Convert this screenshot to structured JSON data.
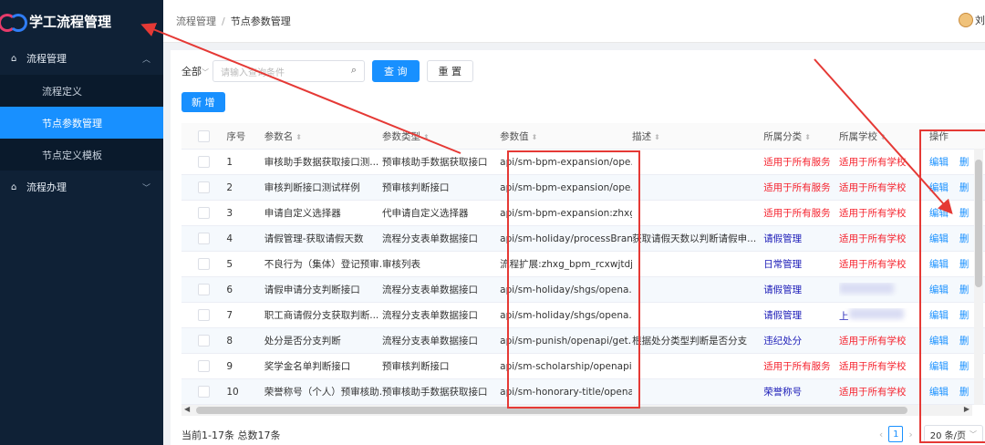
{
  "app": {
    "title": "学工流程管理"
  },
  "sidebar": {
    "groups": [
      {
        "label": "流程管理",
        "items": [
          "流程定义",
          "节点参数管理",
          "节点定义模板"
        ]
      },
      {
        "label": "流程办理"
      }
    ]
  },
  "header": {
    "breadcrumb": [
      "流程管理",
      "节点参数管理"
    ],
    "user_name": "刘"
  },
  "toolbar": {
    "scope": "全部",
    "search_placeholder": "请输入查询条件",
    "query_label": "查 询",
    "reset_label": "重 置",
    "add_label": "新 增"
  },
  "table": {
    "columns": [
      "序号",
      "参数名",
      "参数类型",
      "参数值",
      "描述",
      "所属分类",
      "所属学校",
      "操作"
    ],
    "rows": [
      {
        "idx": "1",
        "name": "审核助手数据获取接口测...",
        "type": "预审核助手数据获取接口",
        "value": "api/sm-bpm-expansion/ope...",
        "desc": "",
        "category": "适用于所有服务",
        "cat_color": "red",
        "school": "适用于所有学校",
        "sch_color": "red"
      },
      {
        "idx": "2",
        "name": "审核判断接口测试样例",
        "type": "预审核判断接口",
        "value": "api/sm-bpm-expansion/ope...",
        "desc": "",
        "category": "适用于所有服务",
        "cat_color": "red",
        "school": "适用于所有学校",
        "sch_color": "red"
      },
      {
        "idx": "3",
        "name": "申请自定义选择器",
        "type": "代申请自定义选择器",
        "value": "api/sm-bpm-expansion:zhxg...",
        "desc": "",
        "category": "适用于所有服务",
        "cat_color": "red",
        "school": "适用于所有学校",
        "sch_color": "red"
      },
      {
        "idx": "4",
        "name": "请假管理-获取请假天数",
        "type": "流程分支表单数据接口",
        "value": "api/sm-holiday/processBran...",
        "desc": "获取请假天数以判断请假申...",
        "category": "请假管理",
        "cat_color": "blue",
        "school": "适用于所有学校",
        "sch_color": "red"
      },
      {
        "idx": "5",
        "name": "不良行为（集体）登记预审...",
        "type": "审核列表",
        "value": "流程扩展:zhxg_bpm_rcxwjtdj...",
        "desc": "",
        "category": "日常管理",
        "cat_color": "blue",
        "school": "适用于所有学校",
        "sch_color": "red"
      },
      {
        "idx": "6",
        "name": "请假申请分支判断接口",
        "type": "流程分支表单数据接口",
        "value": "api/sm-holiday/shgs/opena...",
        "desc": "",
        "category": "请假管理",
        "cat_color": "blue",
        "school": "",
        "sch_color": "blur"
      },
      {
        "idx": "7",
        "name": "职工商请假分支获取判断...",
        "type": "流程分支表单数据接口",
        "value": "api/sm-holiday/shgs/opena...",
        "desc": "",
        "category": "请假管理",
        "cat_color": "blue",
        "school": "上",
        "sch_color": "blur"
      },
      {
        "idx": "8",
        "name": "处分是否分支判断",
        "type": "流程分支表单数据接口",
        "value": "api/sm-punish/openapi/get...",
        "desc": "根据处分类型判断是否分支",
        "category": "违纪处分",
        "cat_color": "blue",
        "school": "适用于所有学校",
        "sch_color": "red"
      },
      {
        "idx": "9",
        "name": "奖学金名单判断接口",
        "type": "预审核判断接口",
        "value": "api/sm-scholarship/openapi...",
        "desc": "",
        "category": "适用于所有服务",
        "cat_color": "red",
        "school": "适用于所有学校",
        "sch_color": "red"
      },
      {
        "idx": "10",
        "name": "荣誉称号（个人）预审核助...",
        "type": "预审核助手数据获取接口",
        "value": "api/sm-honorary-title/opena...",
        "desc": "",
        "category": "荣誉称号",
        "cat_color": "blue",
        "school": "适用于所有学校",
        "sch_color": "red"
      }
    ],
    "edit_label": "编辑",
    "delete_label": "删"
  },
  "footer": {
    "summary": "当前1-17条 总数17条",
    "current_page": "1",
    "page_size": "20 条/页"
  },
  "colors": {
    "sidebar_bg": "#0f2136",
    "accent": "#1890ff",
    "annotation": "#e53935"
  }
}
